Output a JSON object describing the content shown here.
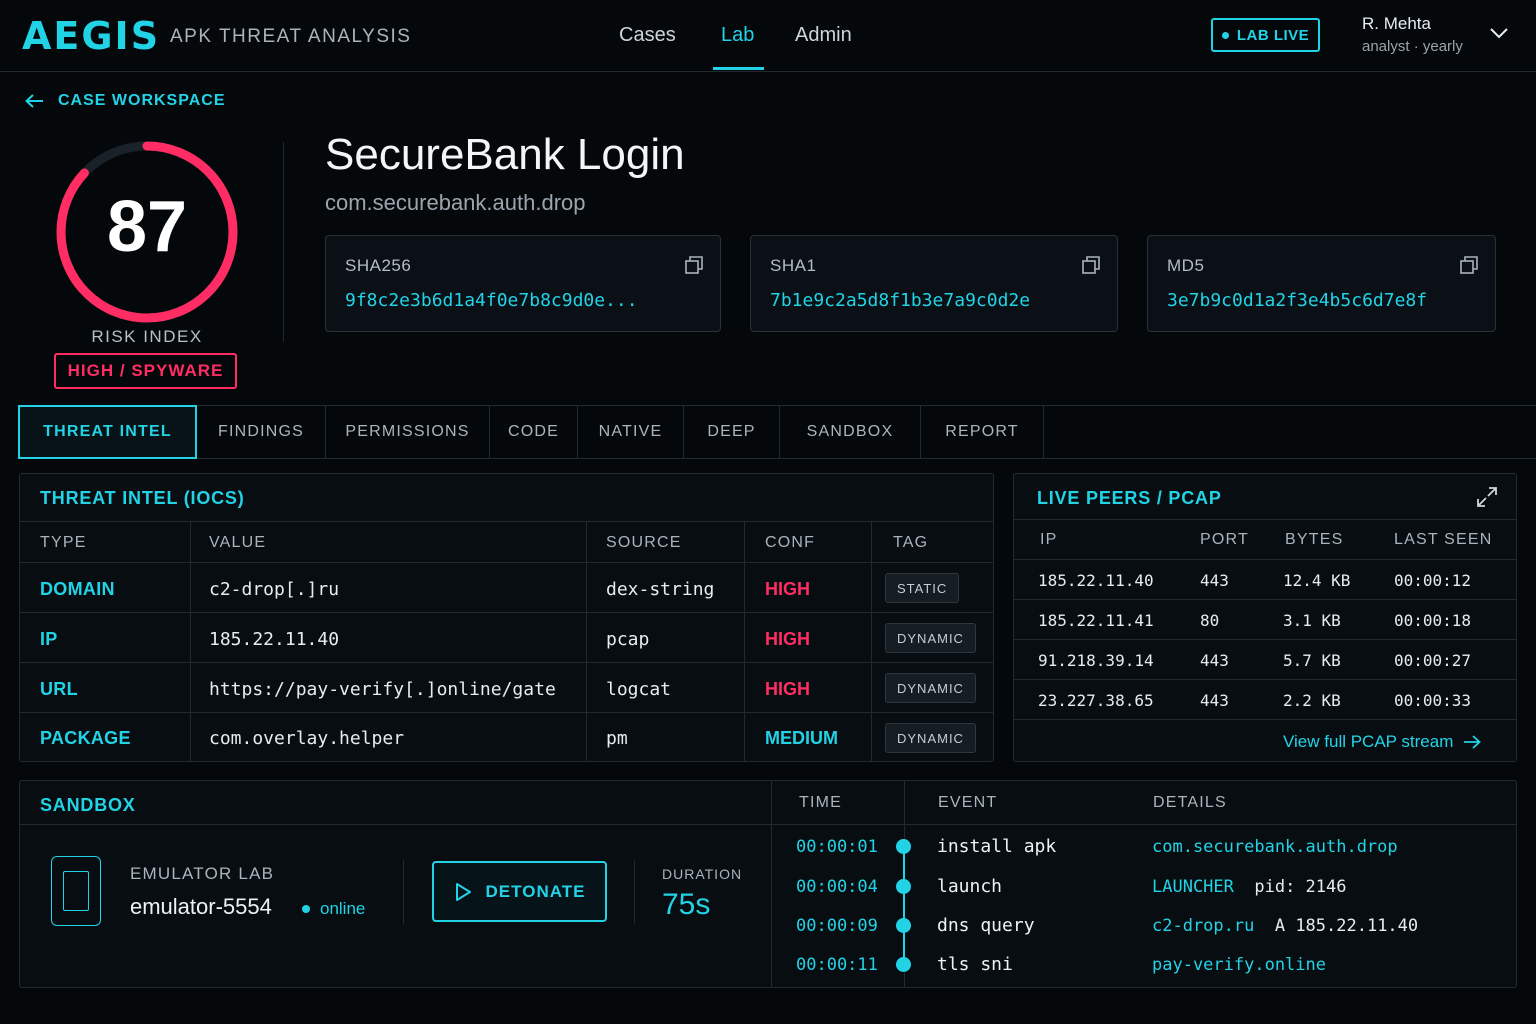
{
  "header": {
    "logo": "AEGIS",
    "subtitle": "APK THREAT ANALYSIS",
    "nav": [
      {
        "label": "Cases"
      },
      {
        "label": "Lab",
        "active": true
      },
      {
        "label": "Admin"
      }
    ],
    "live_badge": "LAB LIVE",
    "user": {
      "name": "R. Mehta",
      "role": "analyst · yearly"
    }
  },
  "back_link": "CASE WORKSPACE",
  "risk": {
    "score": "87",
    "score_fraction": 0.87,
    "label": "RISK INDEX",
    "badge": "HIGH / SPYWARE"
  },
  "app": {
    "title": "SecureBank Login",
    "package": "com.securebank.auth.drop"
  },
  "hashes": [
    {
      "label": "SHA256",
      "value": "9f8c2e3b6d1a4f0e7b8c9d0e..."
    },
    {
      "label": "SHA1",
      "value": "7b1e9c2a5d8f1b3e7a9c0d2e"
    },
    {
      "label": "MD5",
      "value": "3e7b9c0d1a2f3e4b5c6d7e8f"
    }
  ],
  "tabs": [
    "THREAT INTEL",
    "FINDINGS",
    "PERMISSIONS",
    "CODE",
    "NATIVE",
    "DEEP",
    "SANDBOX",
    "REPORT"
  ],
  "iocs": {
    "title": "THREAT INTEL (IOCS)",
    "columns": [
      "TYPE",
      "VALUE",
      "SOURCE",
      "CONF",
      "TAG"
    ],
    "rows": [
      {
        "type": "DOMAIN",
        "value": "c2-drop[.]ru",
        "source": "dex-string",
        "conf": "HIGH",
        "tag": "STATIC"
      },
      {
        "type": "IP",
        "value": "185.22.11.40",
        "source": "pcap",
        "conf": "HIGH",
        "tag": "DYNAMIC"
      },
      {
        "type": "URL",
        "value": "https://pay-verify[.]online/gate",
        "source": "logcat",
        "conf": "HIGH",
        "tag": "DYNAMIC"
      },
      {
        "type": "PACKAGE",
        "value": "com.overlay.helper",
        "source": "pm",
        "conf": "MEDIUM",
        "tag": "DYNAMIC"
      }
    ]
  },
  "peers": {
    "title": "LIVE PEERS / PCAP",
    "columns": [
      "IP",
      "PORT",
      "BYTES",
      "LAST SEEN"
    ],
    "rows": [
      {
        "ip": "185.22.11.40",
        "port": "443",
        "bytes": "12.4 KB",
        "last_seen": "00:00:12"
      },
      {
        "ip": "185.22.11.41",
        "port": "80",
        "bytes": "3.1 KB",
        "last_seen": "00:00:18"
      },
      {
        "ip": "91.218.39.14",
        "port": "443",
        "bytes": "5.7 KB",
        "last_seen": "00:00:27"
      },
      {
        "ip": "23.227.38.65",
        "port": "443",
        "bytes": "2.2 KB",
        "last_seen": "00:00:33"
      }
    ],
    "link": "View full PCAP stream"
  },
  "sandbox": {
    "title": "SANDBOX",
    "emulator_label": "EMULATOR LAB",
    "emulator_name": "emulator-5554",
    "status": "online",
    "detonate_label": "DETONATE",
    "duration_label": "DURATION",
    "duration_value": "75s",
    "columns": [
      "TIME",
      "EVENT",
      "DETAILS"
    ],
    "events": [
      {
        "time": "00:00:01",
        "event": "install apk",
        "detail": "com.securebank.auth.drop",
        "detail_extra": ""
      },
      {
        "time": "00:00:04",
        "event": "launch",
        "detail": "LAUNCHER",
        "detail_extra": "pid: 2146"
      },
      {
        "time": "00:00:09",
        "event": "dns query",
        "detail": "c2-drop.ru",
        "detail_extra": "A 185.22.11.40"
      },
      {
        "time": "00:00:11",
        "event": "tls sni",
        "detail": "pay-verify.online",
        "detail_extra": ""
      }
    ]
  },
  "colors": {
    "accent": "#22d3e6",
    "danger": "#ff2d63",
    "background": "#05080b"
  }
}
